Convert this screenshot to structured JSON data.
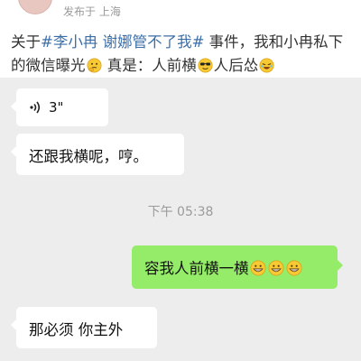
{
  "post": {
    "meta": "发布于 上海",
    "text_before": "关于",
    "hashtag": "#李小冉 谢娜管不了我#",
    "text_after_hashtag": " 事件，我和小冉私下的微信曝光",
    "text_mid": " 真是：人前横",
    "text_mid2": "人后怂"
  },
  "chat": {
    "voice_duration": "3\"",
    "msg_incoming_1": "还跟我横呢，哼。",
    "timestamp": "下午 05:38",
    "msg_outgoing_1": "容我人前横一横",
    "msg_incoming_2": "那必须 你主外"
  },
  "colors": {
    "chat_background": "#ededed",
    "outgoing_bubble": "#95ec69",
    "incoming_bubble": "#ffffff",
    "hashtag": "#3b6ea8"
  },
  "icons": [
    "voice-icon",
    "thinking-emoji",
    "sunglasses-emoji",
    "laughing-emoji",
    "grinning-emoji"
  ]
}
